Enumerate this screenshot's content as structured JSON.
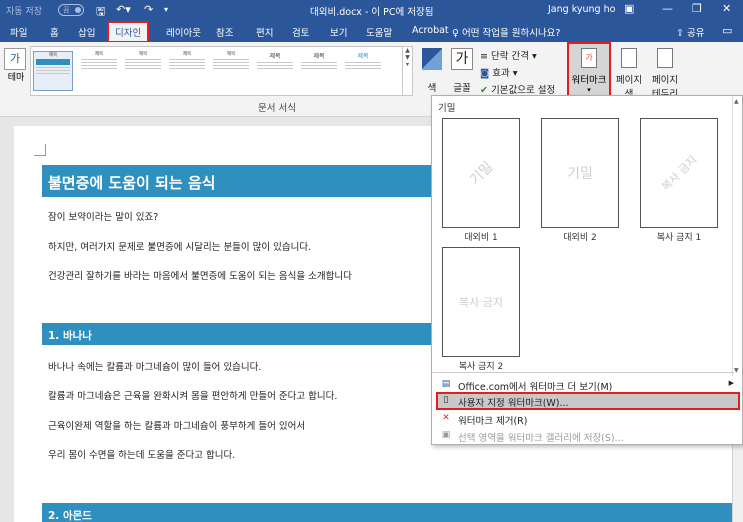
{
  "titlebar": {
    "autosave": "자동 저장",
    "autosave_state": "끔",
    "save_icon": "save-icon",
    "undo_icon": "undo-icon",
    "redo_icon": "redo-icon",
    "doc_title": "대외비.docx - 이 PC에 저장됨",
    "user": "Jang kyung ho",
    "ribbon_display_icon": "▣",
    "minimize": "—",
    "restore": "❐",
    "close": "✕"
  },
  "tabs": [
    "파일",
    "홈",
    "삽입",
    "디자인",
    "레이아웃",
    "참조",
    "편지",
    "검토",
    "보기",
    "도움말",
    "Acrobat"
  ],
  "active_tab": "디자인",
  "tell_me": "어떤 작업을 원하시나요?",
  "share": "공유",
  "ribbon": {
    "theme_label": "테마",
    "theme_icon_text": "가",
    "gallery_titles": [
      "제목",
      "제목",
      "제목",
      "제목",
      "제목",
      "제목",
      "제목",
      "제목",
      "제목",
      "제목"
    ],
    "group_label": "문서 서식",
    "colors_label": "색",
    "fonts_label": "글꼴",
    "fonts_icon_text": "가",
    "paragraph_spacing": "단락 간격 ▾",
    "effects": "효과 ▾",
    "set_default": "기본값으로 설정",
    "watermark_label": "워터마크",
    "watermark_icon_text": "가",
    "page_color_label": "페이지 색",
    "page_border_label_1": "페이지",
    "page_border_label_2": "테두리"
  },
  "document": {
    "title": "불면증에 도움이 되는 음식",
    "paragraphs": [
      "잠이 보약이라는 말이 있죠?",
      "하지만, 여러가지 문제로 불면증에 시달리는 분들이 많이 있습니다.",
      "건강관리 잘하기를 바라는 마음에서 불면증에 도움이 되는 음식을 소개합니다"
    ],
    "section1_title": "1. 바나나",
    "section1_paragraphs": [
      "바나나 속에는 칼륨과 마그네슘이 많이 들어 있습니다.",
      "칼륨과 마그네슘은 근육을 완화시켜 몸을 편안하게 만들어 준다고 합니다.",
      "근육이완제 역할을 하는 칼륨과 마그네슘이 풍부하게 들어 있어서",
      "우리 몸이 수면을 하는데 도움을 준다고 합니다."
    ],
    "section2_title": "2. 아몬드"
  },
  "watermark_menu": {
    "header": "기밀",
    "tiles": [
      {
        "text": "기밀",
        "label": "대외비 1",
        "diagonal": true
      },
      {
        "text": "기밀",
        "label": "대외비 2",
        "diagonal": false
      },
      {
        "text": "복사 금지",
        "label": "복사 금지 1",
        "diagonal": true
      },
      {
        "text": "복사 금지",
        "label": "복사 금지 2",
        "diagonal": false
      }
    ],
    "items": [
      {
        "label": "Office.com에서 워터마크 더 보기(M)",
        "enabled": true,
        "submenu": true
      },
      {
        "label": "사용자 지정 워터마크(W)...",
        "enabled": true,
        "highlighted": true
      },
      {
        "label": "워터마크 제거(R)",
        "enabled": true
      },
      {
        "label": "선택 영역을 워터마크 갤러리에 저장(S)...",
        "enabled": false
      }
    ]
  },
  "colors": {
    "accent": "#2b579a",
    "heading": "#2f8fbf",
    "highlight_border": "#e02020"
  }
}
